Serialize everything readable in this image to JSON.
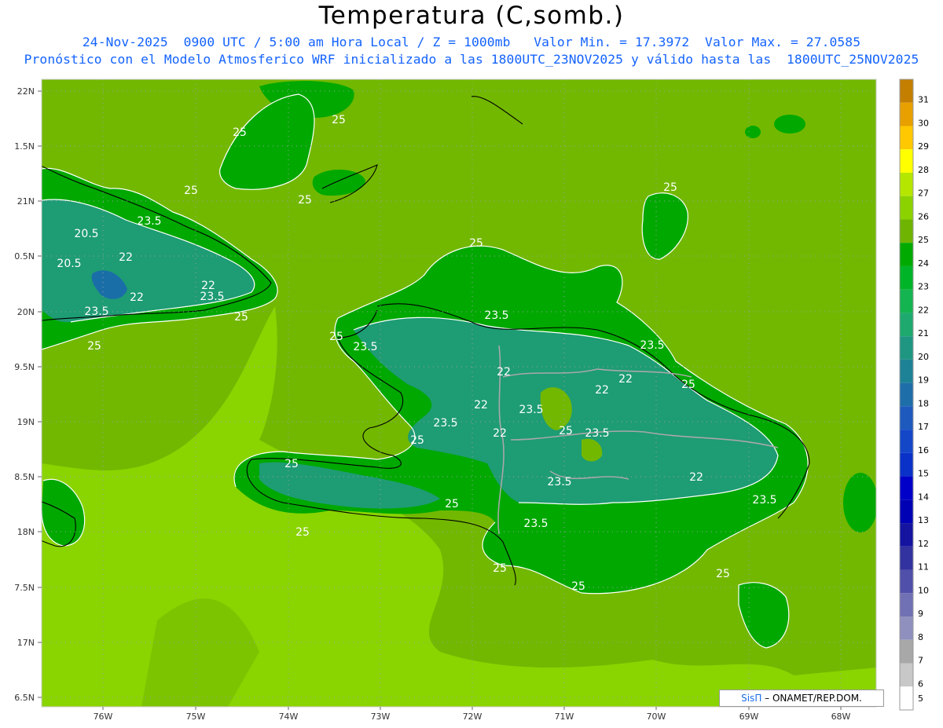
{
  "header": {
    "title": "Temperatura (C,somb.)",
    "line1": "24-Nov-2025  0900 UTC / 5:00 am Hora Local / Z = 1000mb   Valor Min. = 17.3972  Valor Max. = 27.0585",
    "line2": "Pronóstico con el Modelo Atmosferico WRF inicializado a las 1800UTC_23NOV2025 y válido hasta las  1800UTC_25NOV2025"
  },
  "map": {
    "lon_labels": [
      "76W",
      "75W",
      "74W",
      "73W",
      "72W",
      "71W",
      "70W",
      "69W",
      "68W"
    ],
    "lat_labels": [
      "22N",
      "1.5N",
      "21N",
      "0.5N",
      "20N",
      "9.5N",
      "19N",
      "8.5N",
      "18N",
      "7.5N",
      "17N",
      "6.5N"
    ],
    "contour_labels": [
      "25",
      "25",
      "25",
      "25",
      "23.5",
      "20.5",
      "22",
      "20.5",
      "22",
      "22",
      "23.5",
      "23.5",
      "25",
      "25",
      "25",
      "25",
      "23.5",
      "25",
      "23.5",
      "23.5",
      "22",
      "22",
      "22",
      "25",
      "23.5",
      "22",
      "25",
      "23.5",
      "22",
      "23.5",
      "25",
      "25",
      "25",
      "23.5",
      "25",
      "23.5",
      "22",
      "25",
      "25",
      "25",
      "23.5"
    ],
    "colors": {
      "ocean": "#72b800",
      "warm_sea": "#8ad400",
      "land_green": "#00a800",
      "land_teal": "#1e9c74",
      "land_deep": "#1a6ea8",
      "grid": "#9aa0a8"
    }
  },
  "colorbar": {
    "labels": [
      "31",
      "30",
      "29",
      "28",
      "27",
      "26",
      "25",
      "24",
      "23",
      "22",
      "21",
      "20",
      "19",
      "18",
      "17",
      "16",
      "15",
      "14",
      "13",
      "12",
      "11",
      "10",
      "9",
      "8",
      "7",
      "6",
      "5"
    ],
    "colors": [
      "#c47f00",
      "#e8a000",
      "#ffc800",
      "#ffff00",
      "#b4e600",
      "#8cd200",
      "#6eb400",
      "#00aa00",
      "#00b428",
      "#14b450",
      "#1eaa6e",
      "#1e9682",
      "#1e8296",
      "#1e6eaa",
      "#1e5abe",
      "#1446c8",
      "#0a32c8",
      "#0000c8",
      "#0000b4",
      "#1414a0",
      "#3232a0",
      "#5050aa",
      "#7070b4",
      "#9090be",
      "#a8a8a8",
      "#c8c8c8",
      "#ffffff"
    ]
  },
  "credit": {
    "brand": "SisΠ",
    "text": " – ONAMET/REP.DOM."
  }
}
